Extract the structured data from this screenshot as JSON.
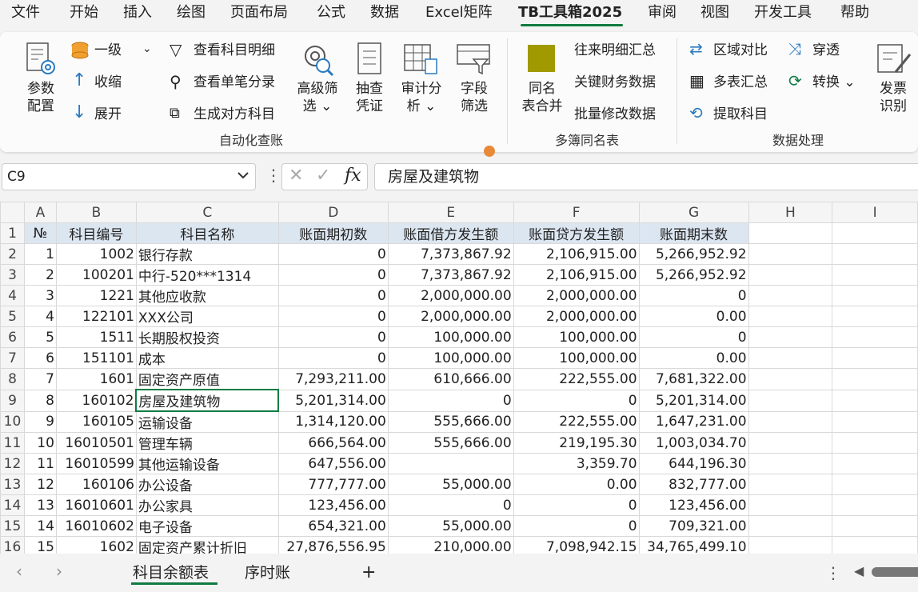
{
  "menu": [
    "文件",
    "开始",
    "插入",
    "绘图",
    "页面布局",
    "公式",
    "数据",
    "Excel矩阵",
    "TB工具箱2025",
    "审阅",
    "视图",
    "开发工具",
    "帮助"
  ],
  "ribbon": {
    "param_config": [
      "参数",
      "配置"
    ],
    "level1": "一级",
    "collapse": "收缩",
    "expand": "展开",
    "view_subject_detail": "查看科目明细",
    "view_single_entry": "查看单笔分录",
    "gen_counter_subject": "生成对方科目",
    "advanced_filter": [
      "高级筛",
      "选 ⌄"
    ],
    "sample_voucher": [
      "抽查",
      "凭证"
    ],
    "audit_analysis": [
      "审计分",
      "析 ⌄"
    ],
    "field_filter": [
      "字段",
      "筛选"
    ],
    "group_auto_check": "自动化查账",
    "same_name_merge": [
      "同名",
      "表合并"
    ],
    "ar_ap_summary": "往来明细汇总",
    "key_finance_data": "关键财务数据",
    "batch_modify": "批量修改数据",
    "group_multi_book": "多簿同名表",
    "region_compare": "区域对比",
    "multi_table_sum": "多表汇总",
    "extract_subject": "提取科目",
    "drill_through": "穿透",
    "convert": "转换 ⌄",
    "invoice_recognize": [
      "发票",
      "识别"
    ],
    "group_data_process": "数据处理"
  },
  "formula_bar": {
    "name_box": "C9",
    "formula": "房屋及建筑物"
  },
  "columns": [
    "A",
    "B",
    "C",
    "D",
    "E",
    "F",
    "G",
    "H",
    "I"
  ],
  "header_row": [
    "№",
    "科目编号",
    "科目名称",
    "账面期初数",
    "账面借方发生额",
    "账面贷方发生额",
    "账面期末数"
  ],
  "rows": [
    [
      "1",
      "1002",
      "银行存款",
      "0",
      "7,373,867.92",
      "2,106,915.00",
      "5,266,952.92"
    ],
    [
      "2",
      "100201",
      "中行-520***1314",
      "0",
      "7,373,867.92",
      "2,106,915.00",
      "5,266,952.92"
    ],
    [
      "3",
      "1221",
      "其他应收款",
      "0",
      "2,000,000.00",
      "2,000,000.00",
      "0"
    ],
    [
      "4",
      "122101",
      "XXX公司",
      "0",
      "2,000,000.00",
      "2,000,000.00",
      "0.00"
    ],
    [
      "5",
      "1511",
      "长期股权投资",
      "0",
      "100,000.00",
      "100,000.00",
      "0"
    ],
    [
      "6",
      "151101",
      "成本",
      "0",
      "100,000.00",
      "100,000.00",
      "0.00"
    ],
    [
      "7",
      "1601",
      "固定资产原值",
      "7,293,211.00",
      "610,666.00",
      "222,555.00",
      "7,681,322.00"
    ],
    [
      "8",
      "160102",
      "房屋及建筑物",
      "5,201,314.00",
      "0",
      "0",
      "5,201,314.00"
    ],
    [
      "9",
      "160105",
      "运输设备",
      "1,314,120.00",
      "555,666.00",
      "222,555.00",
      "1,647,231.00"
    ],
    [
      "10",
      "16010501",
      "管理车辆",
      "666,564.00",
      "555,666.00",
      "219,195.30",
      "1,003,034.70"
    ],
    [
      "11",
      "16010599",
      "其他运输设备",
      "647,556.00",
      "",
      "3,359.70",
      "644,196.30"
    ],
    [
      "12",
      "160106",
      "办公设备",
      "777,777.00",
      "55,000.00",
      "0.00",
      "832,777.00"
    ],
    [
      "13",
      "16010601",
      "办公家具",
      "123,456.00",
      "0",
      "0",
      "123,456.00"
    ],
    [
      "14",
      "16010602",
      "电子设备",
      "654,321.00",
      "55,000.00",
      "0",
      "709,321.00"
    ],
    [
      "15",
      "1602",
      "固定资产累计折旧",
      "27,876,556.95",
      "210,000.00",
      "7,098,942.15",
      "34,765,499.10"
    ]
  ],
  "tabs": [
    "科目余额表",
    "序时账"
  ],
  "add_sheet": "+"
}
